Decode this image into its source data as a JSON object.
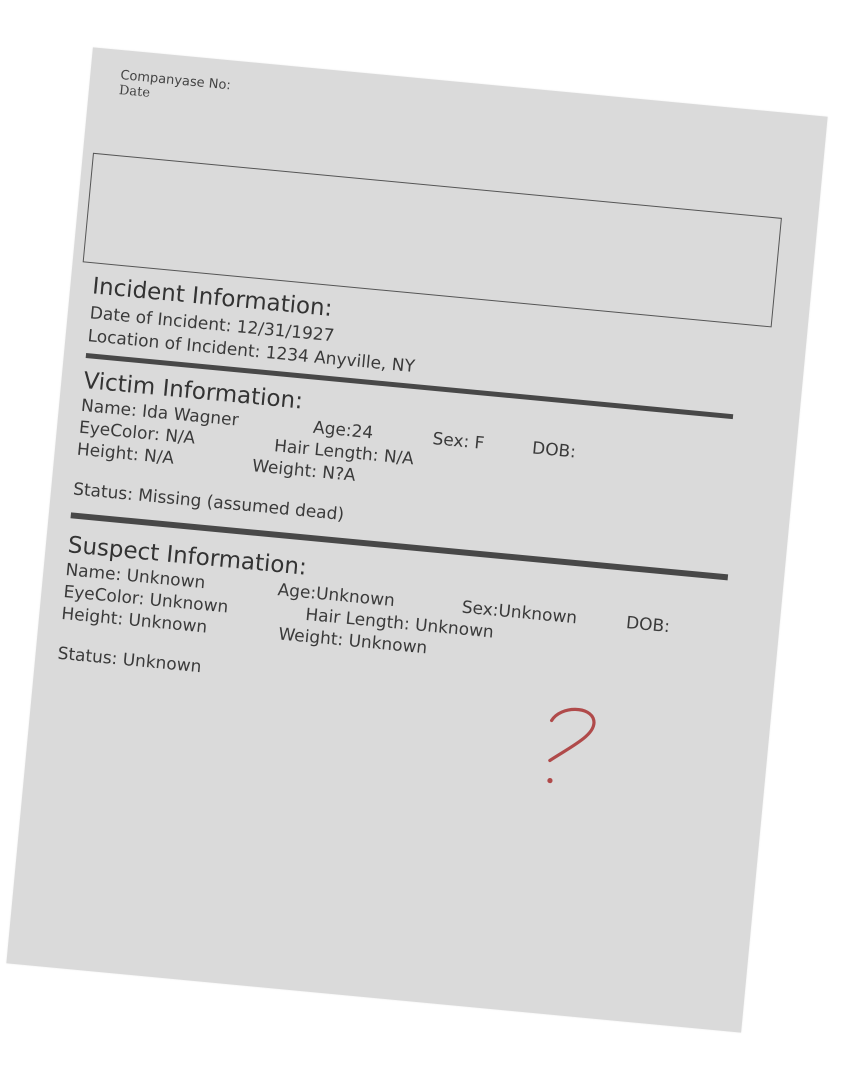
{
  "header": {
    "case_label": "Companyase No:",
    "date_label": "Date"
  },
  "incident": {
    "heading": "Incident Information:",
    "date": "Date of Incident: 12/31/1927",
    "location": "Location of Incident: 1234 Anyville, NY"
  },
  "victim": {
    "heading": "Victim Information:",
    "name": "Name: Ida Wagner",
    "age": "Age:24",
    "sex": "Sex: F",
    "dob": "DOB:",
    "eye_color": "EyeColor: N/A",
    "hair_length": "Hair Length: N/A",
    "height": "Height: N/A",
    "weight": "Weight: N?A",
    "status": "Status: Missing (assumed dead)"
  },
  "suspect": {
    "heading": "Suspect Information:",
    "name": "Name: Unknown",
    "age": "Age:Unknown",
    "sex": "Sex:Unknown",
    "dob": "DOB:",
    "eye_color": "EyeColor: Unknown",
    "hair_length": "Hair Length: Unknown",
    "height": "Height: Unknown",
    "weight": "Weight: Unknown",
    "status": "Status: Unknown"
  },
  "annotation": {
    "mark": "?",
    "mark_color": "#b04a4a"
  },
  "colors": {
    "paper": "#dadada",
    "ink": "#3a3a3a",
    "rule": "#484848"
  }
}
